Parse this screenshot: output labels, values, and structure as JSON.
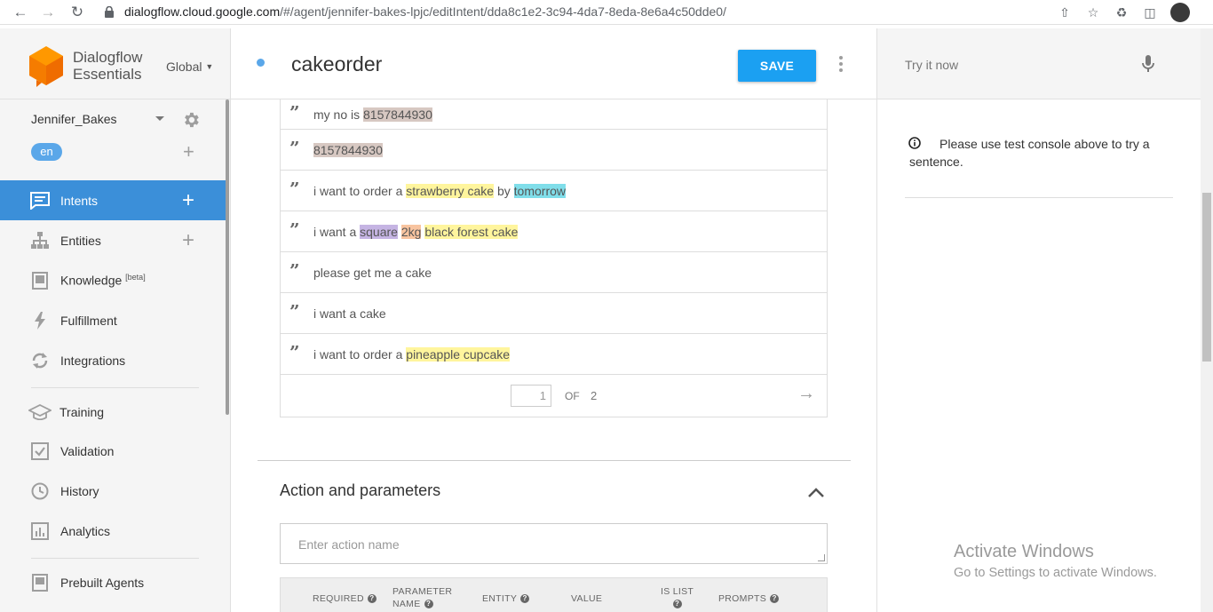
{
  "browser": {
    "url_host": "dialogflow.cloud.google.com",
    "url_path": "/#/agent/jennifer-bakes-lpjc/editIntent/dda8c1e2-3c94-4da7-8eda-8e6a4c50dde0/"
  },
  "sidebar": {
    "brand_line1": "Dialogflow",
    "brand_line2": "Essentials",
    "region": "Global",
    "agent_name": "Jennifer_Bakes",
    "language": "en",
    "items": [
      {
        "label": "Intents",
        "icon": "chat-icon",
        "active": true
      },
      {
        "label": "Entities",
        "icon": "hierarchy-icon"
      },
      {
        "label": "Knowledge",
        "icon": "book-icon",
        "badge": "[beta]"
      },
      {
        "label": "Fulfillment",
        "icon": "bolt-icon"
      },
      {
        "label": "Integrations",
        "icon": "sync-icon"
      },
      {
        "label": "Training",
        "icon": "graduation-cap-icon"
      },
      {
        "label": "Validation",
        "icon": "check-box-icon"
      },
      {
        "label": "History",
        "icon": "clock-icon"
      },
      {
        "label": "Analytics",
        "icon": "bar-chart-icon"
      },
      {
        "label": "Prebuilt Agents",
        "icon": "bookmark-book-icon"
      }
    ]
  },
  "header": {
    "intent_name": "cakeorder",
    "save_label": "SAVE"
  },
  "phrases": [
    {
      "segments": [
        {
          "t": "my no is "
        },
        {
          "t": "8157844930",
          "c": "num"
        }
      ]
    },
    {
      "segments": [
        {
          "t": "8157844930",
          "c": "num"
        }
      ]
    },
    {
      "segments": [
        {
          "t": "i want to order a "
        },
        {
          "t": "strawberry cake",
          "c": "yellow"
        },
        {
          "t": " by "
        },
        {
          "t": "tomorrow",
          "c": "cyan"
        }
      ]
    },
    {
      "segments": [
        {
          "t": "i want a "
        },
        {
          "t": "square",
          "c": "purple"
        },
        {
          "t": " "
        },
        {
          "t": "2kg",
          "c": "orange"
        },
        {
          "t": " "
        },
        {
          "t": "black forest cake",
          "c": "yellow"
        }
      ]
    },
    {
      "segments": [
        {
          "t": "please get me a cake"
        }
      ]
    },
    {
      "segments": [
        {
          "t": "i want a cake"
        }
      ]
    },
    {
      "segments": [
        {
          "t": "i want to order a "
        },
        {
          "t": "pineapple cupcake",
          "c": "yellow"
        }
      ]
    }
  ],
  "pager": {
    "current": "1",
    "of_label": "OF",
    "total": "2"
  },
  "action_section": {
    "title": "Action and parameters",
    "placeholder": "Enter action name",
    "columns": {
      "required": "REQUIRED",
      "param_line1": "PARAMETER",
      "param_line2": "NAME",
      "entity": "ENTITY",
      "value": "VALUE",
      "islist_line1": "IS LIST",
      "prompts": "PROMPTS"
    }
  },
  "right_panel": {
    "try_placeholder": "Try it now",
    "info": "Please use test console above to try a sentence.",
    "watermark_title": "Activate Windows",
    "watermark_sub": "Go to Settings to activate Windows."
  }
}
